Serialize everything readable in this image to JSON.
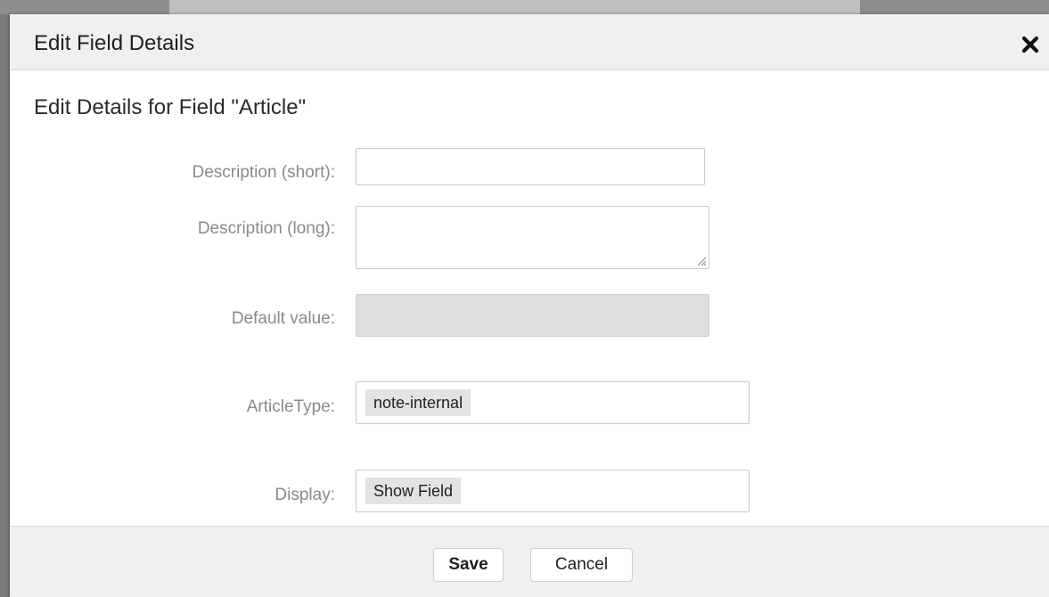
{
  "dialog": {
    "title": "Edit Field Details",
    "section_title": "Edit Details for Field \"Article\"",
    "close_icon": "close-icon"
  },
  "fields": {
    "description_short": {
      "label": "Description (short):",
      "value": ""
    },
    "description_long": {
      "label": "Description (long):",
      "value": ""
    },
    "default_value": {
      "label": "Default value:",
      "value": ""
    },
    "article_type": {
      "label": "ArticleType:",
      "selected": "note-internal"
    },
    "display": {
      "label": "Display:",
      "selected": "Show Field"
    }
  },
  "footer": {
    "save_label": "Save",
    "cancel_label": "Cancel"
  }
}
